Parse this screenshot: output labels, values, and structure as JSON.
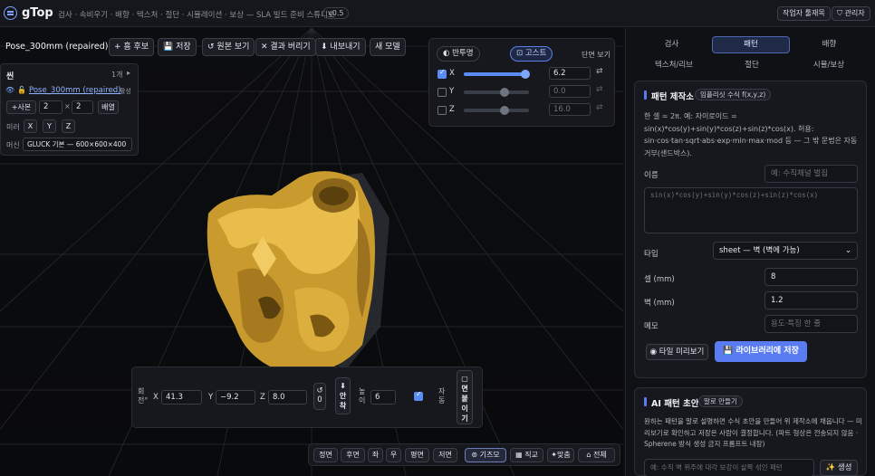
{
  "app": {
    "name": "gTop",
    "nav": "검사 · 속비우기 · 배향 · 텍스처 · 절단 · 시뮬레이션 · 보상 — SLA 빌드 준비 스튜디오",
    "version": "v0.5",
    "queue_button": "작업자 툴재목",
    "admin_button": "관리자"
  },
  "toolbar": {
    "filename": "Pose_300mm (repaired).stl",
    "add_candidate": "+ 흠 후보",
    "save": "저장",
    "view_original": "원본 보기",
    "discard_result": "결과 버리기",
    "export": "내보내기",
    "new_model": "새 모델"
  },
  "scene": {
    "title": "씬",
    "count": "1개",
    "model_name": "Pose_300mm (repaired)",
    "model_suffix": "··· 활성",
    "copy_label": "+사본",
    "copy_count": "2",
    "times": "×",
    "copy_count2": "2",
    "arrange": "배열",
    "mirror_label": "미러",
    "mirror_x": "X",
    "mirror_y": "Y",
    "mirror_z": "Z",
    "machine_label": "머신",
    "machine_value": "GLUCK 기본 — 600×600×400"
  },
  "slicer": {
    "transparency": "반투명",
    "ghost": "고스트",
    "section_view": "단면 보기",
    "axes": [
      {
        "label": "X",
        "value": "6.2",
        "checked": true
      },
      {
        "label": "Y",
        "value": "0.0",
        "checked": false
      },
      {
        "label": "Z",
        "value": "16.0",
        "checked": false
      }
    ]
  },
  "transform": {
    "rotate_label": "회전°",
    "x_label": "X",
    "x_value": "41.3",
    "y_label": "Y",
    "y_value": "−9.2",
    "z_label": "Z",
    "z_value": "8.0",
    "reset_value": "0",
    "settle": "안착",
    "height_label": "높이",
    "height_value": "6",
    "auto_label": "자동",
    "face_lay": "면붙이기"
  },
  "viewbar": {
    "buttons": [
      "정면",
      "후면",
      "좌",
      "우",
      "평면",
      "저면",
      "기즈모",
      "직교",
      "맞춤",
      "전체"
    ]
  },
  "tabs": [
    {
      "label": "검사"
    },
    {
      "label": "패턴"
    },
    {
      "label": "배향"
    },
    {
      "label": "텍스처/리브"
    },
    {
      "label": "절단"
    },
    {
      "label": "시뮬/보상"
    }
  ],
  "pattern_card": {
    "title": "패턴 제작소",
    "tag": "임플리싯 수식 f(x,y,z)",
    "description": "한 셀 = 2π. 예: 자이로이드 = sin(x)*cos(y)+sin(y)*cos(z)+sin(z)*cos(x). 허용: sin·cos·tan·sqrt·abs·exp·min·max·mod 등 — 그 밖 문법은 자동 거부(샌드박스).",
    "name_label": "이름",
    "name_placeholder": "예: 수직채널 벌집",
    "formula_placeholder": "sin(x)*cos(y)+sin(y)*cos(z)+sin(z)*cos(x)",
    "type_label": "타입",
    "type_value": "sheet — 벽 (벽에 가능)",
    "cell_label": "셀 (mm)",
    "cell_value": "8",
    "wall_label": "벽 (mm)",
    "wall_value": "1.2",
    "memo_label": "메모",
    "memo_placeholder": "용도·특징 한 줄",
    "preview_button": "타일 미리보기",
    "save_button": "라이브러리에 저장"
  },
  "ai_card": {
    "title": "AI 패턴 초안",
    "tag": "말로 만들기",
    "description": "원하는 패턴을 말로 설명하면 수식 초안을 만들어 위 제작소에 채웁니다 — 미리보기로 확인하고 저장은 사람이 결정합니다. (파트 형상은 전송되지 않음 · Spherene 방식 생성 금지 프롬프트 내장)",
    "input_placeholder": "예: 수직 벽 위주에 대각 보강이 살짝 섞인 패턴",
    "generate_button": "생성"
  },
  "colors": {
    "accent": "#5a7cf2",
    "model_gold": "#e3b341",
    "background": "#0d0f13"
  }
}
